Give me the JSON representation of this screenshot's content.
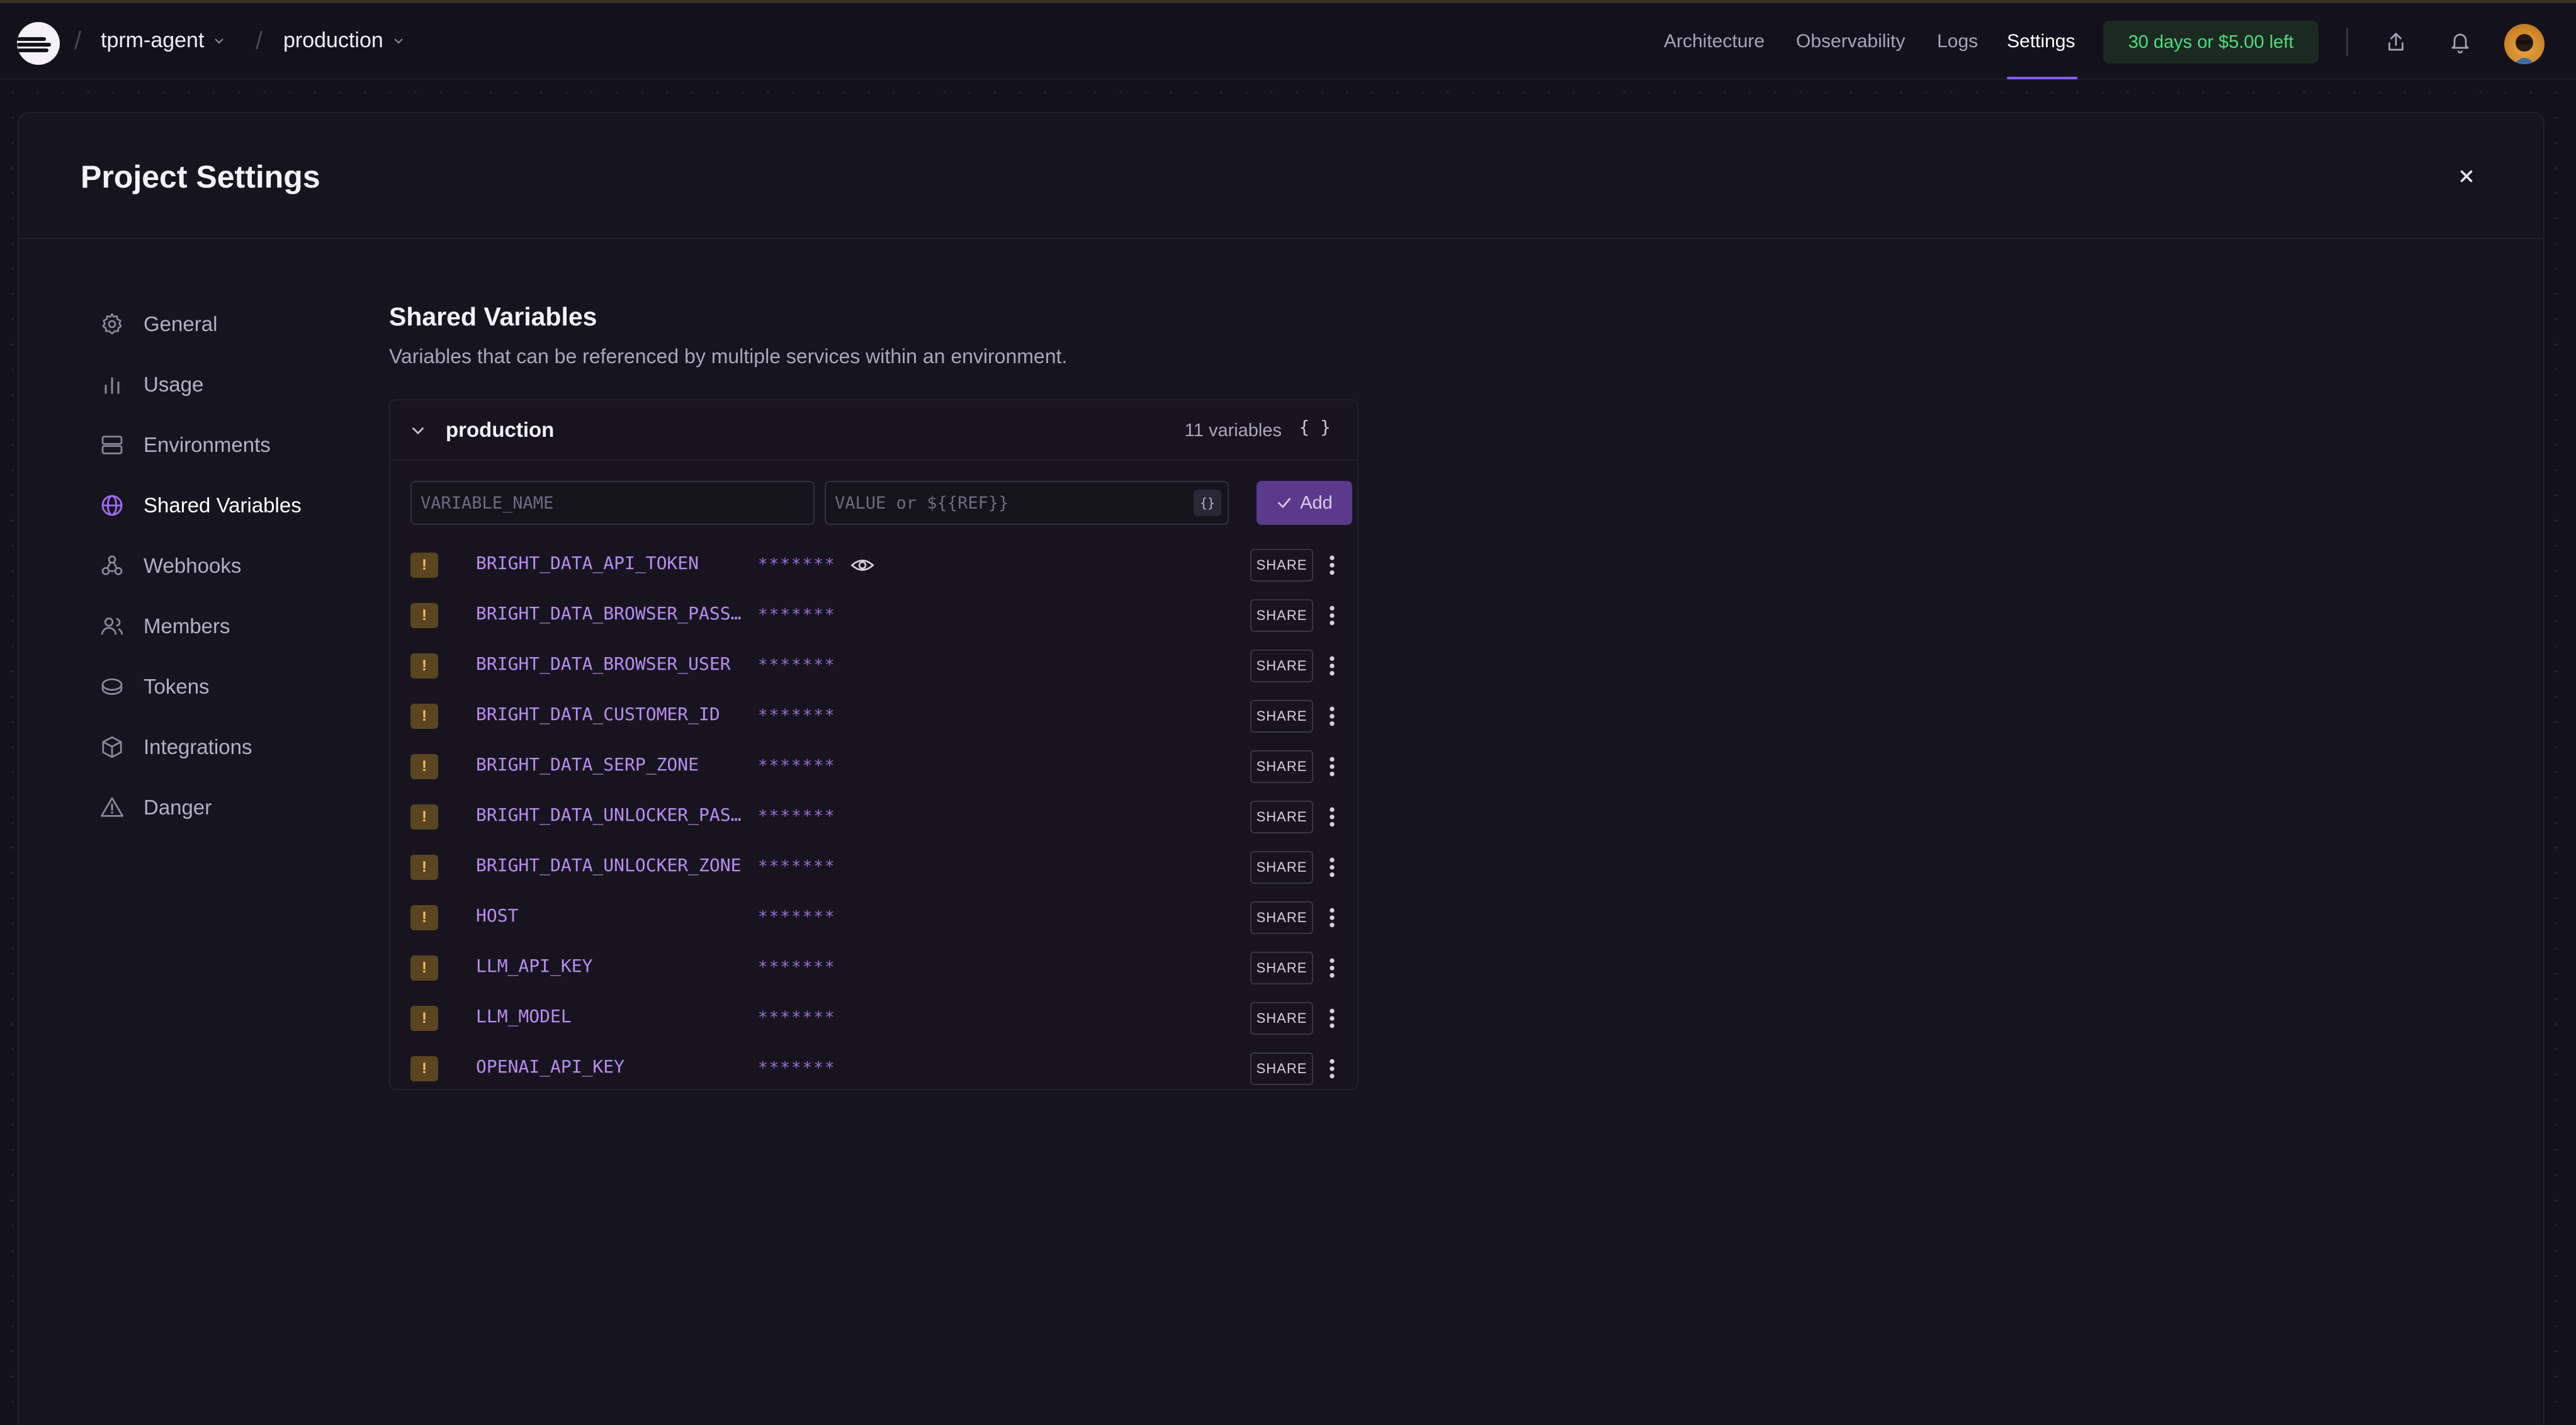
{
  "topbar": {
    "project": "tprm-agent",
    "environment": "production",
    "nav": [
      "Architecture",
      "Observability",
      "Logs",
      "Settings"
    ],
    "active_nav": "Settings",
    "trial": "30 days or $5.00 left"
  },
  "modal": {
    "title": "Project Settings"
  },
  "sidebar": {
    "items": [
      {
        "label": "General",
        "icon": "gear-icon"
      },
      {
        "label": "Usage",
        "icon": "bar-chart-icon"
      },
      {
        "label": "Environments",
        "icon": "server-icon"
      },
      {
        "label": "Shared Variables",
        "icon": "globe-icon"
      },
      {
        "label": "Webhooks",
        "icon": "webhook-icon"
      },
      {
        "label": "Members",
        "icon": "users-icon"
      },
      {
        "label": "Tokens",
        "icon": "token-icon"
      },
      {
        "label": "Integrations",
        "icon": "cube-icon"
      },
      {
        "label": "Danger",
        "icon": "warning-icon"
      }
    ],
    "active": "Shared Variables"
  },
  "content": {
    "title": "Shared Variables",
    "description": "Variables that can be referenced by multiple services within an environment.",
    "env_name": "production",
    "var_count": "11 variables",
    "raw_label": "{ }",
    "name_placeholder": "VARIABLE_NAME",
    "value_placeholder": "VALUE or ${{REF}}",
    "ref_label": "{}",
    "add_label": "Add",
    "share_label": "SHARE",
    "warn_label": "!",
    "masked": "*******",
    "variables": [
      "BRIGHT_DATA_API_TOKEN",
      "BRIGHT_DATA_BROWSER_PASS…",
      "BRIGHT_DATA_BROWSER_USER",
      "BRIGHT_DATA_CUSTOMER_ID",
      "BRIGHT_DATA_SERP_ZONE",
      "BRIGHT_DATA_UNLOCKER_PAS…",
      "BRIGHT_DATA_UNLOCKER_ZONE",
      "HOST",
      "LLM_API_KEY",
      "LLM_MODEL",
      "OPENAI_API_KEY"
    ]
  }
}
